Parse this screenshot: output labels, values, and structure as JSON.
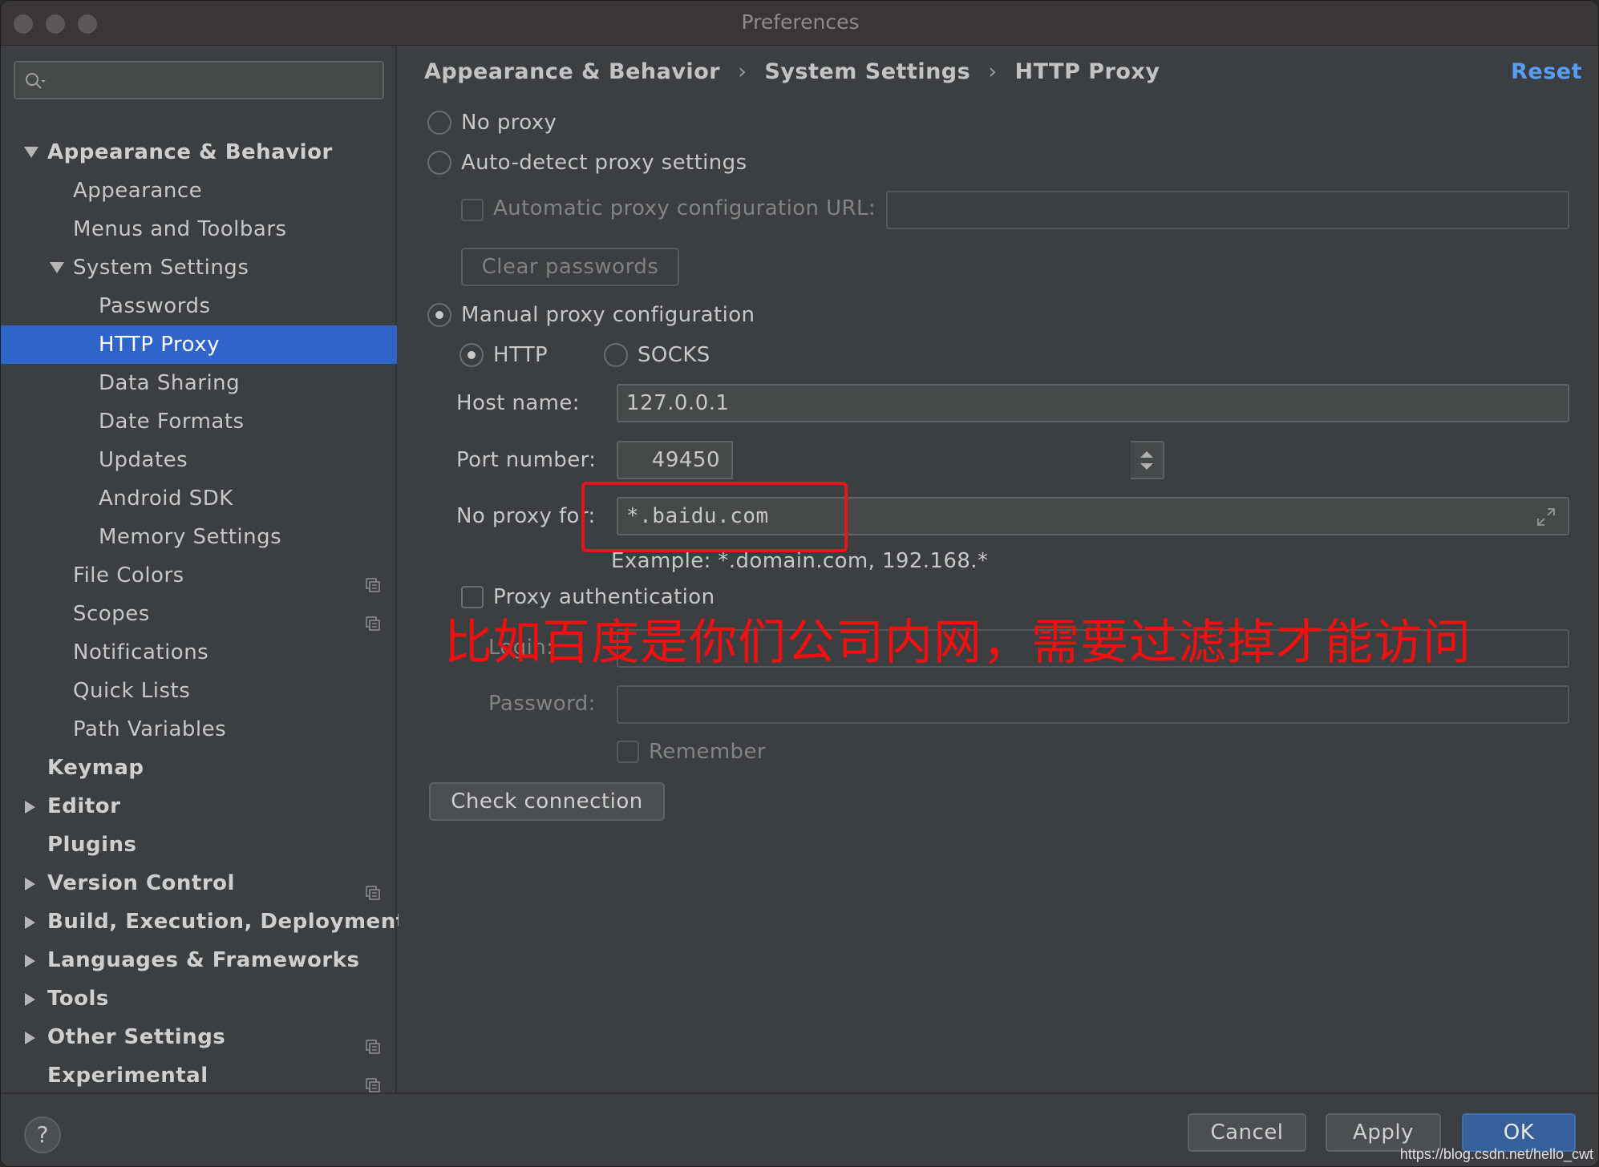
{
  "window": {
    "title": "Preferences"
  },
  "search": {
    "placeholder": ""
  },
  "sidebar": {
    "items": [
      {
        "label": "Appearance & Behavior",
        "level": 0,
        "expanded": true,
        "bold": true
      },
      {
        "label": "Appearance",
        "level": 1
      },
      {
        "label": "Menus and Toolbars",
        "level": 1
      },
      {
        "label": "System Settings",
        "level": 1,
        "expanded": true
      },
      {
        "label": "Passwords",
        "level": 2
      },
      {
        "label": "HTTP Proxy",
        "level": 2,
        "selected": true
      },
      {
        "label": "Data Sharing",
        "level": 2
      },
      {
        "label": "Date Formats",
        "level": 2
      },
      {
        "label": "Updates",
        "level": 2
      },
      {
        "label": "Android SDK",
        "level": 2
      },
      {
        "label": "Memory Settings",
        "level": 2
      },
      {
        "label": "File Colors",
        "level": 1,
        "project": true
      },
      {
        "label": "Scopes",
        "level": 1,
        "project": true
      },
      {
        "label": "Notifications",
        "level": 1
      },
      {
        "label": "Quick Lists",
        "level": 1
      },
      {
        "label": "Path Variables",
        "level": 1
      },
      {
        "label": "Keymap",
        "level": 0,
        "bold": true
      },
      {
        "label": "Editor",
        "level": 0,
        "collapsed": true,
        "bold": true
      },
      {
        "label": "Plugins",
        "level": 0,
        "bold": true
      },
      {
        "label": "Version Control",
        "level": 0,
        "collapsed": true,
        "bold": true,
        "project": true
      },
      {
        "label": "Build, Execution, Deployment",
        "level": 0,
        "collapsed": true,
        "bold": true
      },
      {
        "label": "Languages & Frameworks",
        "level": 0,
        "collapsed": true,
        "bold": true
      },
      {
        "label": "Tools",
        "level": 0,
        "collapsed": true,
        "bold": true
      },
      {
        "label": "Other Settings",
        "level": 0,
        "collapsed": true,
        "bold": true,
        "project": true
      },
      {
        "label": "Experimental",
        "level": 0,
        "bold": true,
        "project": true
      }
    ]
  },
  "breadcrumb": {
    "parts": [
      "Appearance & Behavior",
      "System Settings",
      "HTTP Proxy"
    ],
    "separator": "›"
  },
  "reset_label": "Reset",
  "proxy": {
    "no_proxy": "No proxy",
    "auto_detect": "Auto-detect proxy settings",
    "auto_config_url_label": "Automatic proxy configuration URL:",
    "auto_config_url_value": "",
    "clear_passwords": "Clear passwords",
    "manual": "Manual proxy configuration",
    "http": "HTTP",
    "socks": "SOCKS",
    "host_label": "Host name:",
    "host_value": "127.0.0.1",
    "port_label": "Port number:",
    "port_value": "49450",
    "no_proxy_for_label": "No proxy for:",
    "no_proxy_for_value": "*.baidu.com",
    "example": "Example: *.domain.com, 192.168.*",
    "proxy_auth": "Proxy authentication",
    "login_label": "Login:",
    "login_value": "",
    "password_label": "Password:",
    "password_value": "",
    "remember": "Remember",
    "check_connection": "Check connection"
  },
  "annotation": {
    "text": "比如百度是你们公司内网，需要过滤掉才能访问",
    "color": "#f01010"
  },
  "footer": {
    "help": "?",
    "cancel": "Cancel",
    "apply": "Apply",
    "ok": "OK"
  },
  "watermark": "https://blog.csdn.net/hello_cwt",
  "colors": {
    "selection": "#2f65ca",
    "link": "#589df6",
    "background": "#3c3f41"
  }
}
